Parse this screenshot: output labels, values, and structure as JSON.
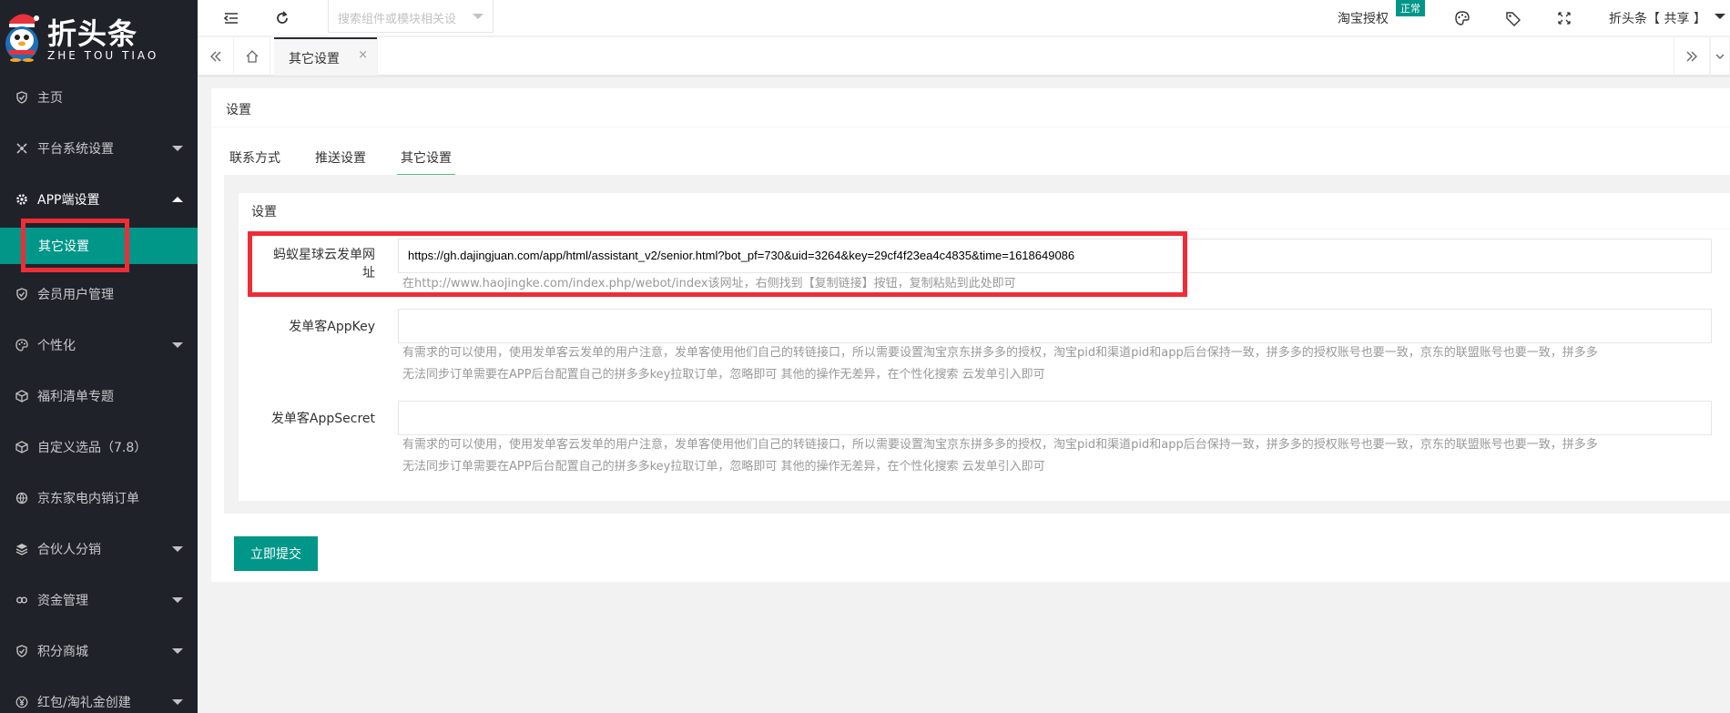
{
  "app": {
    "brand": "折头条",
    "brand_sub": "ZHE TOU TIAO"
  },
  "sidebar": {
    "items": [
      {
        "label": "主页",
        "icon": "shield-icon"
      },
      {
        "label": "平台系统设置",
        "icon": "settings-icon"
      },
      {
        "label": "APP端设置",
        "icon": "gear-icon"
      },
      {
        "label": "其它设置",
        "icon": ""
      },
      {
        "label": "会员用户管理",
        "icon": "shield-icon"
      },
      {
        "label": "个性化",
        "icon": "palette-icon"
      },
      {
        "label": "福利清单专题",
        "icon": "box-icon"
      },
      {
        "label": "自定义选品（7.8）",
        "icon": "box-icon"
      },
      {
        "label": "京东家电内销订单",
        "icon": "globe-icon"
      },
      {
        "label": "合伙人分销",
        "icon": "layers-icon"
      },
      {
        "label": "资金管理",
        "icon": "link-icon"
      },
      {
        "label": "积分商城",
        "icon": "shield-icon"
      },
      {
        "label": "红包/淘礼金创建",
        "icon": "yen-icon"
      }
    ]
  },
  "header": {
    "search_placeholder": "搜索组件或模块相关设",
    "auth_label": "淘宝授权",
    "auth_status": "正常",
    "user_label": "折头条【 共享 】"
  },
  "tabbar": {
    "active_tab": "其它设置",
    "close": "×"
  },
  "card": {
    "title": "设置",
    "tabs": [
      "联系方式",
      "推送设置",
      "其它设置"
    ],
    "inner_title": "设置"
  },
  "form": {
    "field1_label_line1": "蚂蚁星球云发单网",
    "field1_label_line2": "址",
    "field1_value": "https://gh.dajingjuan.com/app/html/assistant_v2/senior.html?bot_pf=730&uid=3264&key=29cf4f23ea4c4835&time=1618649086",
    "field1_hint": "在http://www.haojingke.com/index.php/webot/index该网址，右侧找到【复制链接】按钮，复制粘贴到此处即可",
    "field2_label": "发单客AppKey",
    "field2_value": "",
    "field2_hint_line1": "有需求的可以使用，使用发单客云发单的用户注意，发单客使用他们自己的转链接口，所以需要设置淘宝京东拼多多的授权，淘宝pid和渠道pid和app后台保持一致，拼多多的授权账号也要一致，京东的联盟账号也要一致，拼多多",
    "field2_hint_line2": "无法同步订单需要在APP后台配置自己的拼多多key拉取订单，忽略即可 其他的操作无差异，在个性化搜索 云发单引入即可",
    "field3_label": "发单客AppSecret",
    "field3_value": "",
    "field3_hint_line1": "有需求的可以使用，使用发单客云发单的用户注意，发单客使用他们自己的转链接口，所以需要设置淘宝京东拼多多的授权，淘宝pid和渠道pid和app后台保持一致，拼多多的授权账号也要一致，京东的联盟账号也要一致，拼多多",
    "field3_hint_line2": "无法同步订单需要在APP后台配置自己的拼多多key拉取订单，忽略即可 其他的操作无差异，在个性化搜索 云发单引入即可",
    "submit_label": "立即提交"
  },
  "colors": {
    "accent": "#009688",
    "sidebar_bg": "#20222a",
    "highlight": "#ee2d37"
  }
}
